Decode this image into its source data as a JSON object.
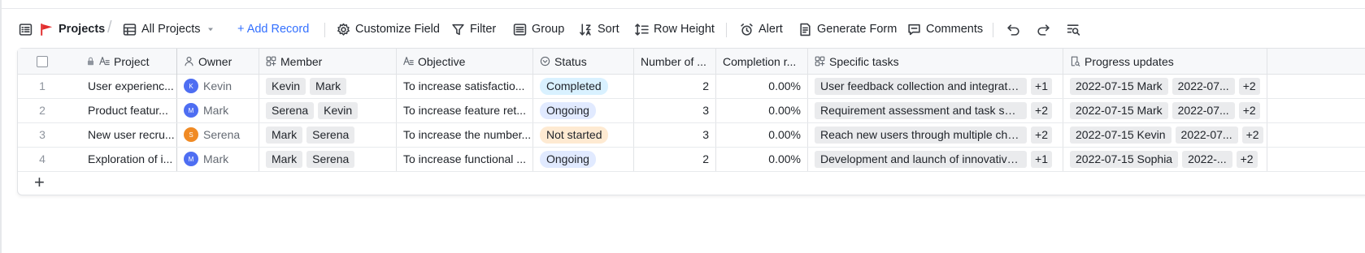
{
  "toolbar": {
    "project_title": "Projects",
    "view_name": "All Projects",
    "add_record": "+ Add Record",
    "customize_field": "Customize Field",
    "filter": "Filter",
    "group": "Group",
    "sort": "Sort",
    "row_height": "Row Height",
    "alert": "Alert",
    "generate_form": "Generate Form",
    "comments": "Comments",
    "colors": {
      "accent": "#3370ff",
      "flag": "#e22e2e"
    }
  },
  "table": {
    "columns": [
      "Project",
      "Owner",
      "Member",
      "Objective",
      "Status",
      "Number of ...",
      "Completion r...",
      "Specific tasks",
      "Progress updates"
    ],
    "rows": [
      {
        "num": "1",
        "project": "User experienc...",
        "owner": {
          "name": "Kevin",
          "initial": "K",
          "color": "#4e6ef2"
        },
        "members": [
          "Kevin",
          "Mark"
        ],
        "objective": "To increase satisfactio...",
        "status": "Completed",
        "status_bg": "#d9f1ff",
        "count": "2",
        "completion": "0.00%",
        "task": "User feedback collection and integration",
        "task_more": "+1",
        "updates": [
          "2022-07-15 Mark",
          "2022-07..."
        ],
        "updates_more": "+2"
      },
      {
        "num": "2",
        "project": "Product featur...",
        "owner": {
          "name": "Mark",
          "initial": "M",
          "color": "#4e6ef2"
        },
        "members": [
          "Serena",
          "Kevin"
        ],
        "objective": "To increase feature ret...",
        "status": "Ongoing",
        "status_bg": "#e1eaff",
        "count": "3",
        "completion": "0.00%",
        "task": "Requirement assessment and task subd...",
        "task_more": "+2",
        "updates": [
          "2022-07-15 Mark",
          "2022-07..."
        ],
        "updates_more": "+2"
      },
      {
        "num": "3",
        "project": "New user recru...",
        "owner": {
          "name": "Serena",
          "initial": "S",
          "color": "#f08a24"
        },
        "members": [
          "Mark",
          "Serena"
        ],
        "objective": "To increase the number...",
        "status": "Not started",
        "status_bg": "#feead2",
        "count": "3",
        "completion": "0.00%",
        "task": "Reach new users through multiple chan...",
        "task_more": "+2",
        "updates": [
          "2022-07-15 Kevin",
          "2022-07..."
        ],
        "updates_more": "+2"
      },
      {
        "num": "4",
        "project": "Exploration of i...",
        "owner": {
          "name": "Mark",
          "initial": "M",
          "color": "#4e6ef2"
        },
        "members": [
          "Mark",
          "Serena"
        ],
        "objective": "To increase functional ...",
        "status": "Ongoing",
        "status_bg": "#e1eaff",
        "count": "2",
        "completion": "0.00%",
        "task": "Development and launch of innovative fe...",
        "task_more": "+1",
        "updates": [
          "2022-07-15 Sophia",
          "2022-..."
        ],
        "updates_more": "+2"
      }
    ],
    "add_row": "+"
  }
}
